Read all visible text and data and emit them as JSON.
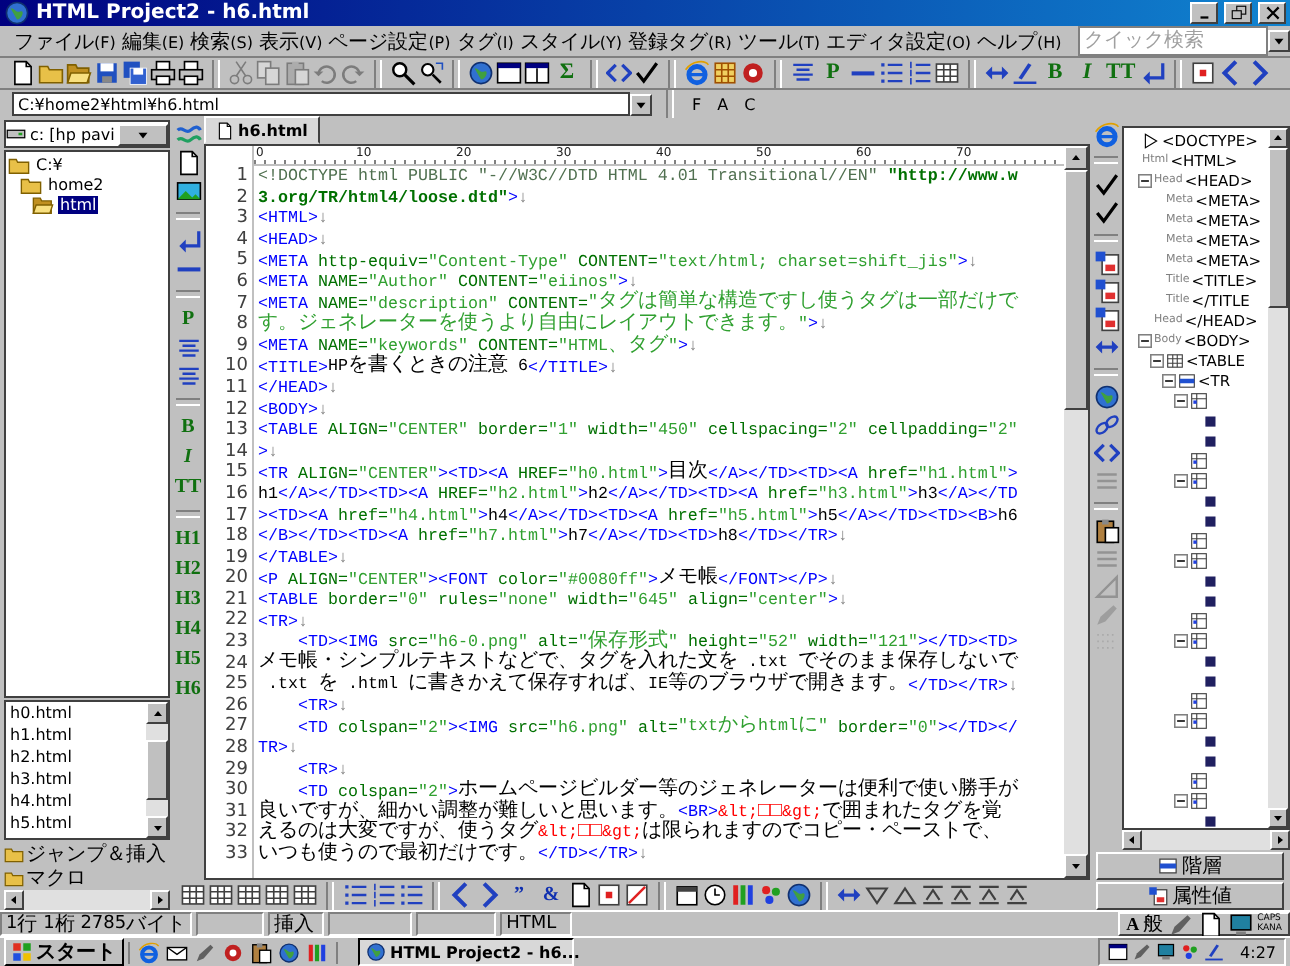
{
  "window": {
    "title": "HTML Project2 - h6.html"
  },
  "menu": [
    "ファイル(F)",
    "編集(E)",
    "検索(S)",
    "表示(V)",
    "ページ設定(P)",
    "タグ(I)",
    "スタイル(Y)",
    "登録タグ(R)",
    "ツール(T)",
    "エディタ設定(O)",
    "ヘルプ(H)"
  ],
  "quick_search": {
    "placeholder": "クイック検索"
  },
  "toolbar": [
    {
      "kind": "document",
      "disabled": false
    },
    {
      "kind": "folder",
      "disabled": false
    },
    {
      "kind": "open-folder",
      "disabled": false
    },
    {
      "kind": "disk",
      "disabled": false
    },
    {
      "kind": "disks",
      "disabled": false
    },
    {
      "kind": "printer",
      "disabled": false
    },
    {
      "kind": "printer",
      "disabled": false
    },
    {
      "kind": "separator"
    },
    {
      "kind": "scissors",
      "disabled": true
    },
    {
      "kind": "copy",
      "disabled": true
    },
    {
      "kind": "clipboard",
      "disabled": true
    },
    {
      "kind": "undo",
      "disabled": true
    },
    {
      "kind": "redo",
      "disabled": true
    },
    {
      "kind": "separator"
    },
    {
      "kind": "search",
      "disabled": false
    },
    {
      "kind": "search-arrow",
      "disabled": false
    },
    {
      "kind": "separator"
    },
    {
      "kind": "globe",
      "disabled": false
    },
    {
      "kind": "window",
      "disabled": false
    },
    {
      "kind": "split-window",
      "disabled": false
    },
    {
      "kind": "glyph",
      "text": "Σ",
      "disabled": false
    },
    {
      "kind": "separator"
    },
    {
      "kind": "brackets",
      "disabled": false
    },
    {
      "kind": "check",
      "disabled": false
    },
    {
      "kind": "separator"
    },
    {
      "kind": "ring",
      "disabled": false
    },
    {
      "kind": "grid",
      "disabled": false
    },
    {
      "kind": "circle",
      "disabled": false
    },
    {
      "kind": "separator"
    },
    {
      "kind": "align",
      "disabled": false
    },
    {
      "kind": "glyph",
      "text": "P",
      "disabled": false
    },
    {
      "kind": "rule",
      "disabled": false
    },
    {
      "kind": "list",
      "disabled": false
    },
    {
      "kind": "numbered-list",
      "disabled": false
    },
    {
      "kind": "table",
      "disabled": false
    },
    {
      "kind": "separator"
    },
    {
      "kind": "double-arrow",
      "disabled": false
    },
    {
      "kind": "pen-underline",
      "disabled": false
    },
    {
      "kind": "glyph",
      "text": "B",
      "disabled": false
    },
    {
      "kind": "italic-glyph",
      "text": "I",
      "disabled": false
    },
    {
      "kind": "glyph",
      "text": "TT",
      "disabled": false
    },
    {
      "kind": "return",
      "disabled": false
    },
    {
      "kind": "separator"
    },
    {
      "kind": "square",
      "disabled": false
    },
    {
      "kind": "chevron-left",
      "disabled": false
    },
    {
      "kind": "chevron-right",
      "disabled": false
    }
  ],
  "address": {
    "value": "C:¥home2¥html¥h6.html",
    "buttons": [
      "F",
      "A",
      "C"
    ]
  },
  "left_panel": {
    "drive": "c: [hp pavi",
    "folders": [
      {
        "name": "C:¥",
        "selected": false,
        "children": [
          {
            "name": "home2",
            "selected": false,
            "children": [
              {
                "name": "html",
                "selected": true
              }
            ]
          }
        ]
      }
    ],
    "files": [
      {
        "name": "h0.html",
        "selected": false
      },
      {
        "name": "h1.html",
        "selected": false
      },
      {
        "name": "h2.html",
        "selected": false
      },
      {
        "name": "h3.html",
        "selected": false
      },
      {
        "name": "h4.html",
        "selected": false
      },
      {
        "name": "h5.html",
        "selected": false
      }
    ],
    "sections": [
      "ジャンプ＆挿入",
      "マクロ"
    ]
  },
  "left_strip": [
    {
      "kind": "waves"
    },
    {
      "kind": "document"
    },
    {
      "kind": "picture"
    },
    {
      "kind": "separator"
    },
    {
      "kind": "return"
    },
    {
      "kind": "rule"
    },
    {
      "kind": "separator"
    },
    {
      "kind": "glyph",
      "text": "P"
    },
    {
      "kind": "align"
    },
    {
      "kind": "align"
    },
    {
      "kind": "separator"
    },
    {
      "kind": "glyph",
      "text": "B"
    },
    {
      "kind": "italic-glyph",
      "text": "I"
    },
    {
      "kind": "glyph",
      "text": "TT"
    },
    {
      "kind": "separator"
    },
    {
      "kind": "glyph",
      "text": "H1"
    },
    {
      "kind": "glyph",
      "text": "H2"
    },
    {
      "kind": "glyph",
      "text": "H3"
    },
    {
      "kind": "glyph",
      "text": "H4"
    },
    {
      "kind": "glyph",
      "text": "H5"
    },
    {
      "kind": "glyph",
      "text": "H6"
    }
  ],
  "tabs": [
    {
      "label": "h6.html",
      "selected": true
    }
  ],
  "ruler_marks": [
    "0",
    "10",
    "20",
    "30",
    "40",
    "50",
    "60",
    "70"
  ],
  "editor": {
    "rows": [
      {
        "number": "1",
        "segments": [
          {
            "kind": "doctype",
            "text": "<!DOCTYPE html PUBLIC \"-//W3C//DTD HTML 4.01 Transitional//EN\" "
          },
          {
            "kind": "url",
            "text": "\"http://www.w"
          }
        ]
      },
      {
        "number": "2",
        "segments": [
          {
            "kind": "url",
            "text": "3.org/TR/html4/loose.dtd\""
          },
          {
            "kind": "tag",
            "text": ">"
          },
          {
            "kind": "eol",
            "text": "↓"
          }
        ]
      },
      {
        "number": "3",
        "segments": [
          {
            "kind": "tag",
            "text": "<HTML>"
          },
          {
            "kind": "eol",
            "text": "↓"
          }
        ]
      },
      {
        "number": "4",
        "segments": [
          {
            "kind": "tag",
            "text": "<HEAD>"
          },
          {
            "kind": "eol",
            "text": "↓"
          }
        ]
      },
      {
        "number": "5",
        "segments": [
          {
            "kind": "tag",
            "text": "<META "
          },
          {
            "kind": "attr",
            "text": "http-equiv="
          },
          {
            "kind": "value",
            "text": "\"Content-Type\" "
          },
          {
            "kind": "attr",
            "text": "CONTENT="
          },
          {
            "kind": "value",
            "text": "\"text/html; charset=shift_jis\""
          },
          {
            "kind": "tag",
            "text": ">"
          },
          {
            "kind": "eol",
            "text": "↓"
          }
        ]
      },
      {
        "number": "6",
        "segments": [
          {
            "kind": "tag",
            "text": "<META "
          },
          {
            "kind": "attr",
            "text": "NAME="
          },
          {
            "kind": "value",
            "text": "\"Author\" "
          },
          {
            "kind": "attr",
            "text": "CONTENT="
          },
          {
            "kind": "value",
            "text": "\"eiinos\""
          },
          {
            "kind": "tag",
            "text": ">"
          },
          {
            "kind": "eol",
            "text": "↓"
          }
        ]
      },
      {
        "number": "7",
        "segments": [
          {
            "kind": "tag",
            "text": "<META "
          },
          {
            "kind": "attr",
            "text": "NAME="
          },
          {
            "kind": "value",
            "text": "\"description\" "
          },
          {
            "kind": "attr",
            "text": "CONTENT="
          },
          {
            "kind": "value",
            "text": "\"タグは簡単な構造ですし使うタグは一部だけで"
          }
        ]
      },
      {
        "number": "8",
        "segments": [
          {
            "kind": "value",
            "text": "す。ジェネレーターを使うより自由にレイアウトできます。\""
          },
          {
            "kind": "tag",
            "text": ">"
          },
          {
            "kind": "eol",
            "text": "↓"
          }
        ]
      },
      {
        "number": "9",
        "segments": [
          {
            "kind": "tag",
            "text": "<META "
          },
          {
            "kind": "attr",
            "text": "NAME="
          },
          {
            "kind": "value",
            "text": "\"keywords\" "
          },
          {
            "kind": "attr",
            "text": "CONTENT="
          },
          {
            "kind": "value",
            "text": "\"HTML、タグ\""
          },
          {
            "kind": "tag",
            "text": ">"
          },
          {
            "kind": "eol",
            "text": "↓"
          }
        ]
      },
      {
        "number": "10",
        "segments": [
          {
            "kind": "tag",
            "text": "<TITLE>"
          },
          {
            "kind": "text",
            "text": "HPを書くときの注意 6"
          },
          {
            "kind": "tag",
            "text": "</TITLE>"
          },
          {
            "kind": "eol",
            "text": "↓"
          }
        ]
      },
      {
        "number": "11",
        "segments": [
          {
            "kind": "tag",
            "text": "</HEAD>"
          },
          {
            "kind": "eol",
            "text": "↓"
          }
        ]
      },
      {
        "number": "12",
        "segments": [
          {
            "kind": "tag",
            "text": "<BODY>"
          },
          {
            "kind": "eol",
            "text": "↓"
          }
        ]
      },
      {
        "number": "13",
        "segments": [
          {
            "kind": "tag",
            "text": "<TABLE "
          },
          {
            "kind": "attr",
            "text": "ALIGN="
          },
          {
            "kind": "value",
            "text": "\"CENTER\" "
          },
          {
            "kind": "attr",
            "text": "border="
          },
          {
            "kind": "value",
            "text": "\"1\" "
          },
          {
            "kind": "attr",
            "text": "width="
          },
          {
            "kind": "value",
            "text": "\"450\" "
          },
          {
            "kind": "attr",
            "text": "cellspacing="
          },
          {
            "kind": "value",
            "text": "\"2\" "
          },
          {
            "kind": "attr",
            "text": "cellpadding="
          },
          {
            "kind": "value",
            "text": "\"2\""
          }
        ]
      },
      {
        "number": "14",
        "segments": [
          {
            "kind": "tag",
            "text": ">"
          },
          {
            "kind": "eol",
            "text": "↓"
          }
        ]
      },
      {
        "number": "15",
        "segments": [
          {
            "kind": "tag",
            "text": "<TR "
          },
          {
            "kind": "attr",
            "text": "ALIGN="
          },
          {
            "kind": "value",
            "text": "\"CENTER\""
          },
          {
            "kind": "tag",
            "text": "><TD><A "
          },
          {
            "kind": "attr",
            "text": "HREF="
          },
          {
            "kind": "value",
            "text": "\"h0.html\""
          },
          {
            "kind": "tag",
            "text": ">"
          },
          {
            "kind": "text",
            "text": "目次"
          },
          {
            "kind": "tag",
            "text": "</A></TD><TD><A "
          },
          {
            "kind": "attr",
            "text": "href="
          },
          {
            "kind": "value",
            "text": "\"h1.html\""
          },
          {
            "kind": "tag",
            "text": ">"
          }
        ]
      },
      {
        "number": "16",
        "segments": [
          {
            "kind": "text",
            "text": "h1"
          },
          {
            "kind": "tag",
            "text": "</A></TD><TD><A "
          },
          {
            "kind": "attr",
            "text": "HREF="
          },
          {
            "kind": "value",
            "text": "\"h2.html\""
          },
          {
            "kind": "tag",
            "text": ">"
          },
          {
            "kind": "text",
            "text": "h2"
          },
          {
            "kind": "tag",
            "text": "</A></TD><TD><A "
          },
          {
            "kind": "attr",
            "text": "href="
          },
          {
            "kind": "value",
            "text": "\"h3.html\""
          },
          {
            "kind": "tag",
            "text": ">"
          },
          {
            "kind": "text",
            "text": "h3"
          },
          {
            "kind": "tag",
            "text": "</A></TD"
          }
        ]
      },
      {
        "number": "17",
        "segments": [
          {
            "kind": "tag",
            "text": "><TD><A "
          },
          {
            "kind": "attr",
            "text": "href="
          },
          {
            "kind": "value",
            "text": "\"h4.html\""
          },
          {
            "kind": "tag",
            "text": ">"
          },
          {
            "kind": "text",
            "text": "h4"
          },
          {
            "kind": "tag",
            "text": "</A></TD><TD><A "
          },
          {
            "kind": "attr",
            "text": "href="
          },
          {
            "kind": "value",
            "text": "\"h5.html\""
          },
          {
            "kind": "tag",
            "text": ">"
          },
          {
            "kind": "text",
            "text": "h5"
          },
          {
            "kind": "tag",
            "text": "</A></TD><TD><B>"
          },
          {
            "kind": "text",
            "text": "h6"
          }
        ]
      },
      {
        "number": "18",
        "segments": [
          {
            "kind": "tag",
            "text": "</B></TD><TD><A "
          },
          {
            "kind": "attr",
            "text": "href="
          },
          {
            "kind": "value",
            "text": "\"h7.html\""
          },
          {
            "kind": "tag",
            "text": ">"
          },
          {
            "kind": "text",
            "text": "h7"
          },
          {
            "kind": "tag",
            "text": "</A></TD><TD>"
          },
          {
            "kind": "text",
            "text": "h8"
          },
          {
            "kind": "tag",
            "text": "</TD></TR>"
          },
          {
            "kind": "eol",
            "text": "↓"
          }
        ]
      },
      {
        "number": "19",
        "segments": [
          {
            "kind": "tag",
            "text": "</TABLE>"
          },
          {
            "kind": "eol",
            "text": "↓"
          }
        ]
      },
      {
        "number": "20",
        "segments": [
          {
            "kind": "tag",
            "text": "<P "
          },
          {
            "kind": "attr",
            "text": "ALIGN="
          },
          {
            "kind": "value",
            "text": "\"CENTER\""
          },
          {
            "kind": "tag",
            "text": "><FONT "
          },
          {
            "kind": "attr",
            "text": "color="
          },
          {
            "kind": "value",
            "text": "\"#0080ff\""
          },
          {
            "kind": "tag",
            "text": ">"
          },
          {
            "kind": "text",
            "text": "メモ帳"
          },
          {
            "kind": "tag",
            "text": "</FONT></P>"
          },
          {
            "kind": "eol",
            "text": "↓"
          }
        ]
      },
      {
        "number": "21",
        "segments": [
          {
            "kind": "tag",
            "text": "<TABLE "
          },
          {
            "kind": "attr",
            "text": "border="
          },
          {
            "kind": "value",
            "text": "\"0\" "
          },
          {
            "kind": "attr",
            "text": "rules="
          },
          {
            "kind": "value",
            "text": "\"none\" "
          },
          {
            "kind": "attr",
            "text": "width="
          },
          {
            "kind": "value",
            "text": "\"645\" "
          },
          {
            "kind": "attr",
            "text": "align="
          },
          {
            "kind": "value",
            "text": "\"center\""
          },
          {
            "kind": "tag",
            "text": ">"
          },
          {
            "kind": "eol",
            "text": "↓"
          }
        ]
      },
      {
        "number": "22",
        "segments": [
          {
            "kind": "tag",
            "text": "<TR>"
          },
          {
            "kind": "eol",
            "text": "↓"
          }
        ]
      },
      {
        "number": "23",
        "segments": [
          {
            "kind": "tag",
            "text": "    <TD><IMG "
          },
          {
            "kind": "attr",
            "text": "src="
          },
          {
            "kind": "value",
            "text": "\"h6-0.png\" "
          },
          {
            "kind": "attr",
            "text": "alt="
          },
          {
            "kind": "value",
            "text": "\"保存形式\" "
          },
          {
            "kind": "attr",
            "text": "height="
          },
          {
            "kind": "value",
            "text": "\"52\" "
          },
          {
            "kind": "attr",
            "text": "width="
          },
          {
            "kind": "value",
            "text": "\"121\""
          },
          {
            "kind": "tag",
            "text": "></TD><TD>"
          }
        ]
      },
      {
        "number": "24",
        "segments": [
          {
            "kind": "text",
            "text": "メモ帳・シンプルテキストなどで、タグを入れた文を .txt でそのまま保存しないで"
          }
        ]
      },
      {
        "number": "25",
        "segments": [
          {
            "kind": "text",
            "text": " .txt を .html に書きかえて保存すれば、IE等のブラウザで開きます。"
          },
          {
            "kind": "tag",
            "text": "</TD></TR>"
          },
          {
            "kind": "eol",
            "text": "↓"
          }
        ]
      },
      {
        "number": "26",
        "segments": [
          {
            "kind": "tag",
            "text": "    <TR>"
          },
          {
            "kind": "eol",
            "text": "↓"
          }
        ]
      },
      {
        "number": "27",
        "segments": [
          {
            "kind": "tag",
            "text": "    <TD "
          },
          {
            "kind": "attr",
            "text": "colspan="
          },
          {
            "kind": "value",
            "text": "\"2\""
          },
          {
            "kind": "tag",
            "text": "><IMG "
          },
          {
            "kind": "attr",
            "text": "src="
          },
          {
            "kind": "value",
            "text": "\"h6.png\" "
          },
          {
            "kind": "attr",
            "text": "alt="
          },
          {
            "kind": "value",
            "text": "\"txtからhtmlに\" "
          },
          {
            "kind": "attr",
            "text": "border="
          },
          {
            "kind": "value",
            "text": "\"0\""
          },
          {
            "kind": "tag",
            "text": "></TD></"
          }
        ]
      },
      {
        "number": "28",
        "segments": [
          {
            "kind": "tag",
            "text": "TR>"
          },
          {
            "kind": "eol",
            "text": "↓"
          }
        ]
      },
      {
        "number": "29",
        "segments": [
          {
            "kind": "tag",
            "text": "    <TR>"
          },
          {
            "kind": "eol",
            "text": "↓"
          }
        ]
      },
      {
        "number": "30",
        "segments": [
          {
            "kind": "tag",
            "text": "    <TD "
          },
          {
            "kind": "attr",
            "text": "colspan="
          },
          {
            "kind": "value",
            "text": "\"2\""
          },
          {
            "kind": "tag",
            "text": ">"
          },
          {
            "kind": "text",
            "text": "ホームページビルダー等のジェネレーターは便利で使い勝手が"
          }
        ]
      },
      {
        "number": "31",
        "segments": [
          {
            "kind": "text",
            "text": "良いですが、細かい調整が難しいと思います。"
          },
          {
            "kind": "tag",
            "text": "<BR>"
          },
          {
            "kind": "entity",
            "text": "&lt;□□&gt;"
          },
          {
            "kind": "text",
            "text": "で囲まれたタグを覚"
          }
        ]
      },
      {
        "number": "32",
        "segments": [
          {
            "kind": "text",
            "text": "えるのは大変ですが、使うタグ"
          },
          {
            "kind": "entity",
            "text": "&lt;□□&gt;"
          },
          {
            "kind": "text",
            "text": "は限られますのでコピー・ペーストで、"
          }
        ]
      },
      {
        "number": "33",
        "segments": [
          {
            "kind": "text",
            "text": "いつも使うので最初だけです。"
          },
          {
            "kind": "tag",
            "text": "</TD></TR>"
          },
          {
            "kind": "eol",
            "text": "↓"
          }
        ]
      }
    ]
  },
  "right_strip": [
    {
      "kind": "ring",
      "disabled": false
    },
    {
      "kind": "separator"
    },
    {
      "kind": "check",
      "disabled": false
    },
    {
      "kind": "check",
      "disabled": false
    },
    {
      "kind": "separator"
    },
    {
      "kind": "form",
      "disabled": false
    },
    {
      "kind": "form",
      "disabled": false
    },
    {
      "kind": "form",
      "disabled": false
    },
    {
      "kind": "double-arrow",
      "disabled": false
    },
    {
      "kind": "separator"
    },
    {
      "kind": "globe",
      "disabled": false
    },
    {
      "kind": "link",
      "disabled": false
    },
    {
      "kind": "brackets",
      "disabled": false
    },
    {
      "kind": "lines",
      "disabled": true
    },
    {
      "kind": "separator"
    },
    {
      "kind": "clipboard",
      "disabled": false
    },
    {
      "kind": "lines",
      "disabled": true
    },
    {
      "kind": "triangle",
      "disabled": true
    },
    {
      "kind": "pen",
      "disabled": true
    },
    {
      "kind": "dot-grid",
      "disabled": true
    }
  ],
  "tree": [
    {
      "kind": "doctype",
      "tag": "<DOCTYPE>"
    },
    {
      "kind": "element",
      "type_label": "Html",
      "tag": "<HTML>",
      "children": [
        {
          "kind": "element",
          "type_label": "Head",
          "tag": "<HEAD>",
          "expanded": true,
          "children": [
            {
              "kind": "element",
              "type_label": "Meta",
              "tag": "<META>"
            },
            {
              "kind": "element",
              "type_label": "Meta",
              "tag": "<META>"
            },
            {
              "kind": "element",
              "type_label": "Meta",
              "tag": "<META>"
            },
            {
              "kind": "element",
              "type_label": "Meta",
              "tag": "<META>"
            },
            {
              "kind": "element",
              "type_label": "Title",
              "tag": "<TITLE>"
            },
            {
              "kind": "element",
              "type_label": "Title",
              "tag": "</TITLE"
            }
          ]
        },
        {
          "kind": "element",
          "type_label": "Head",
          "tag": "</HEAD>"
        },
        {
          "kind": "element",
          "type_label": "Body",
          "tag": "<BODY>",
          "expanded": true,
          "children": [
            {
              "kind": "table",
              "tag": "<TABLE",
              "expanded": true,
              "children": [
                {
                  "kind": "row",
                  "tag": "<TR",
                  "expanded": true,
                  "children": [
                    {
                      "kind": "cell",
                      "expanded": true,
                      "children": [
                        {
                          "kind": "link"
                        },
                        {
                          "kind": "link"
                        }
                      ]
                    },
                    {
                      "kind": "cell"
                    },
                    {
                      "kind": "cell",
                      "expanded": true,
                      "children": [
                        {
                          "kind": "link"
                        },
                        {
                          "kind": "link"
                        }
                      ]
                    },
                    {
                      "kind": "cell"
                    },
                    {
                      "kind": "cell",
                      "expanded": true,
                      "children": [
                        {
                          "kind": "link"
                        },
                        {
                          "kind": "link"
                        }
                      ]
                    },
                    {
                      "kind": "cell"
                    },
                    {
                      "kind": "cell",
                      "expanded": true,
                      "children": [
                        {
                          "kind": "link"
                        },
                        {
                          "kind": "link"
                        }
                      ]
                    },
                    {
                      "kind": "cell"
                    },
                    {
                      "kind": "cell",
                      "expanded": true,
                      "children": [
                        {
                          "kind": "link"
                        },
                        {
                          "kind": "link"
                        }
                      ]
                    },
                    {
                      "kind": "cell"
                    },
                    {
                      "kind": "cell",
                      "expanded": true,
                      "children": [
                        {
                          "kind": "link"
                        }
                      ]
                    }
                  ]
                }
              ]
            }
          ]
        }
      ]
    }
  ],
  "bottom_toolbar": [
    {
      "kind": "table"
    },
    {
      "kind": "table"
    },
    {
      "kind": "table"
    },
    {
      "kind": "table"
    },
    {
      "kind": "table"
    },
    {
      "kind": "separator"
    },
    {
      "kind": "list"
    },
    {
      "kind": "numbered-list"
    },
    {
      "kind": "list"
    },
    {
      "kind": "separator"
    },
    {
      "kind": "chevron-left"
    },
    {
      "kind": "chevron-right"
    },
    {
      "kind": "glyph",
      "text": "”"
    },
    {
      "kind": "glyph",
      "text": "&"
    },
    {
      "kind": "document"
    },
    {
      "kind": "square"
    },
    {
      "kind": "slash-square"
    },
    {
      "kind": "separator"
    },
    {
      "kind": "calendar"
    },
    {
      "kind": "clock"
    },
    {
      "kind": "color-bars"
    },
    {
      "kind": "dots"
    },
    {
      "kind": "globe"
    },
    {
      "kind": "separator"
    },
    {
      "kind": "double-arrow"
    },
    {
      "kind": "triangle-down"
    },
    {
      "kind": "triangle-up"
    },
    {
      "kind": "triangle-lines"
    },
    {
      "kind": "triangle-lines"
    },
    {
      "kind": "triangle-lines"
    },
    {
      "kind": "triangle-lines"
    }
  ],
  "tree_buttons": [
    "階層",
    "属性値"
  ],
  "status_bar": {
    "position": "1行 1桁 2785バイト",
    "insert_mode": "挿入",
    "file_type": "HTML"
  },
  "ime": {
    "mode": "A",
    "input": "般",
    "locks": [
      "CAPS",
      "KANA"
    ]
  },
  "taskbar": {
    "start": "スタート",
    "tasks": [
      {
        "label": "HTML Project2 - h6...",
        "selected": true
      }
    ],
    "clock": "4:27"
  }
}
